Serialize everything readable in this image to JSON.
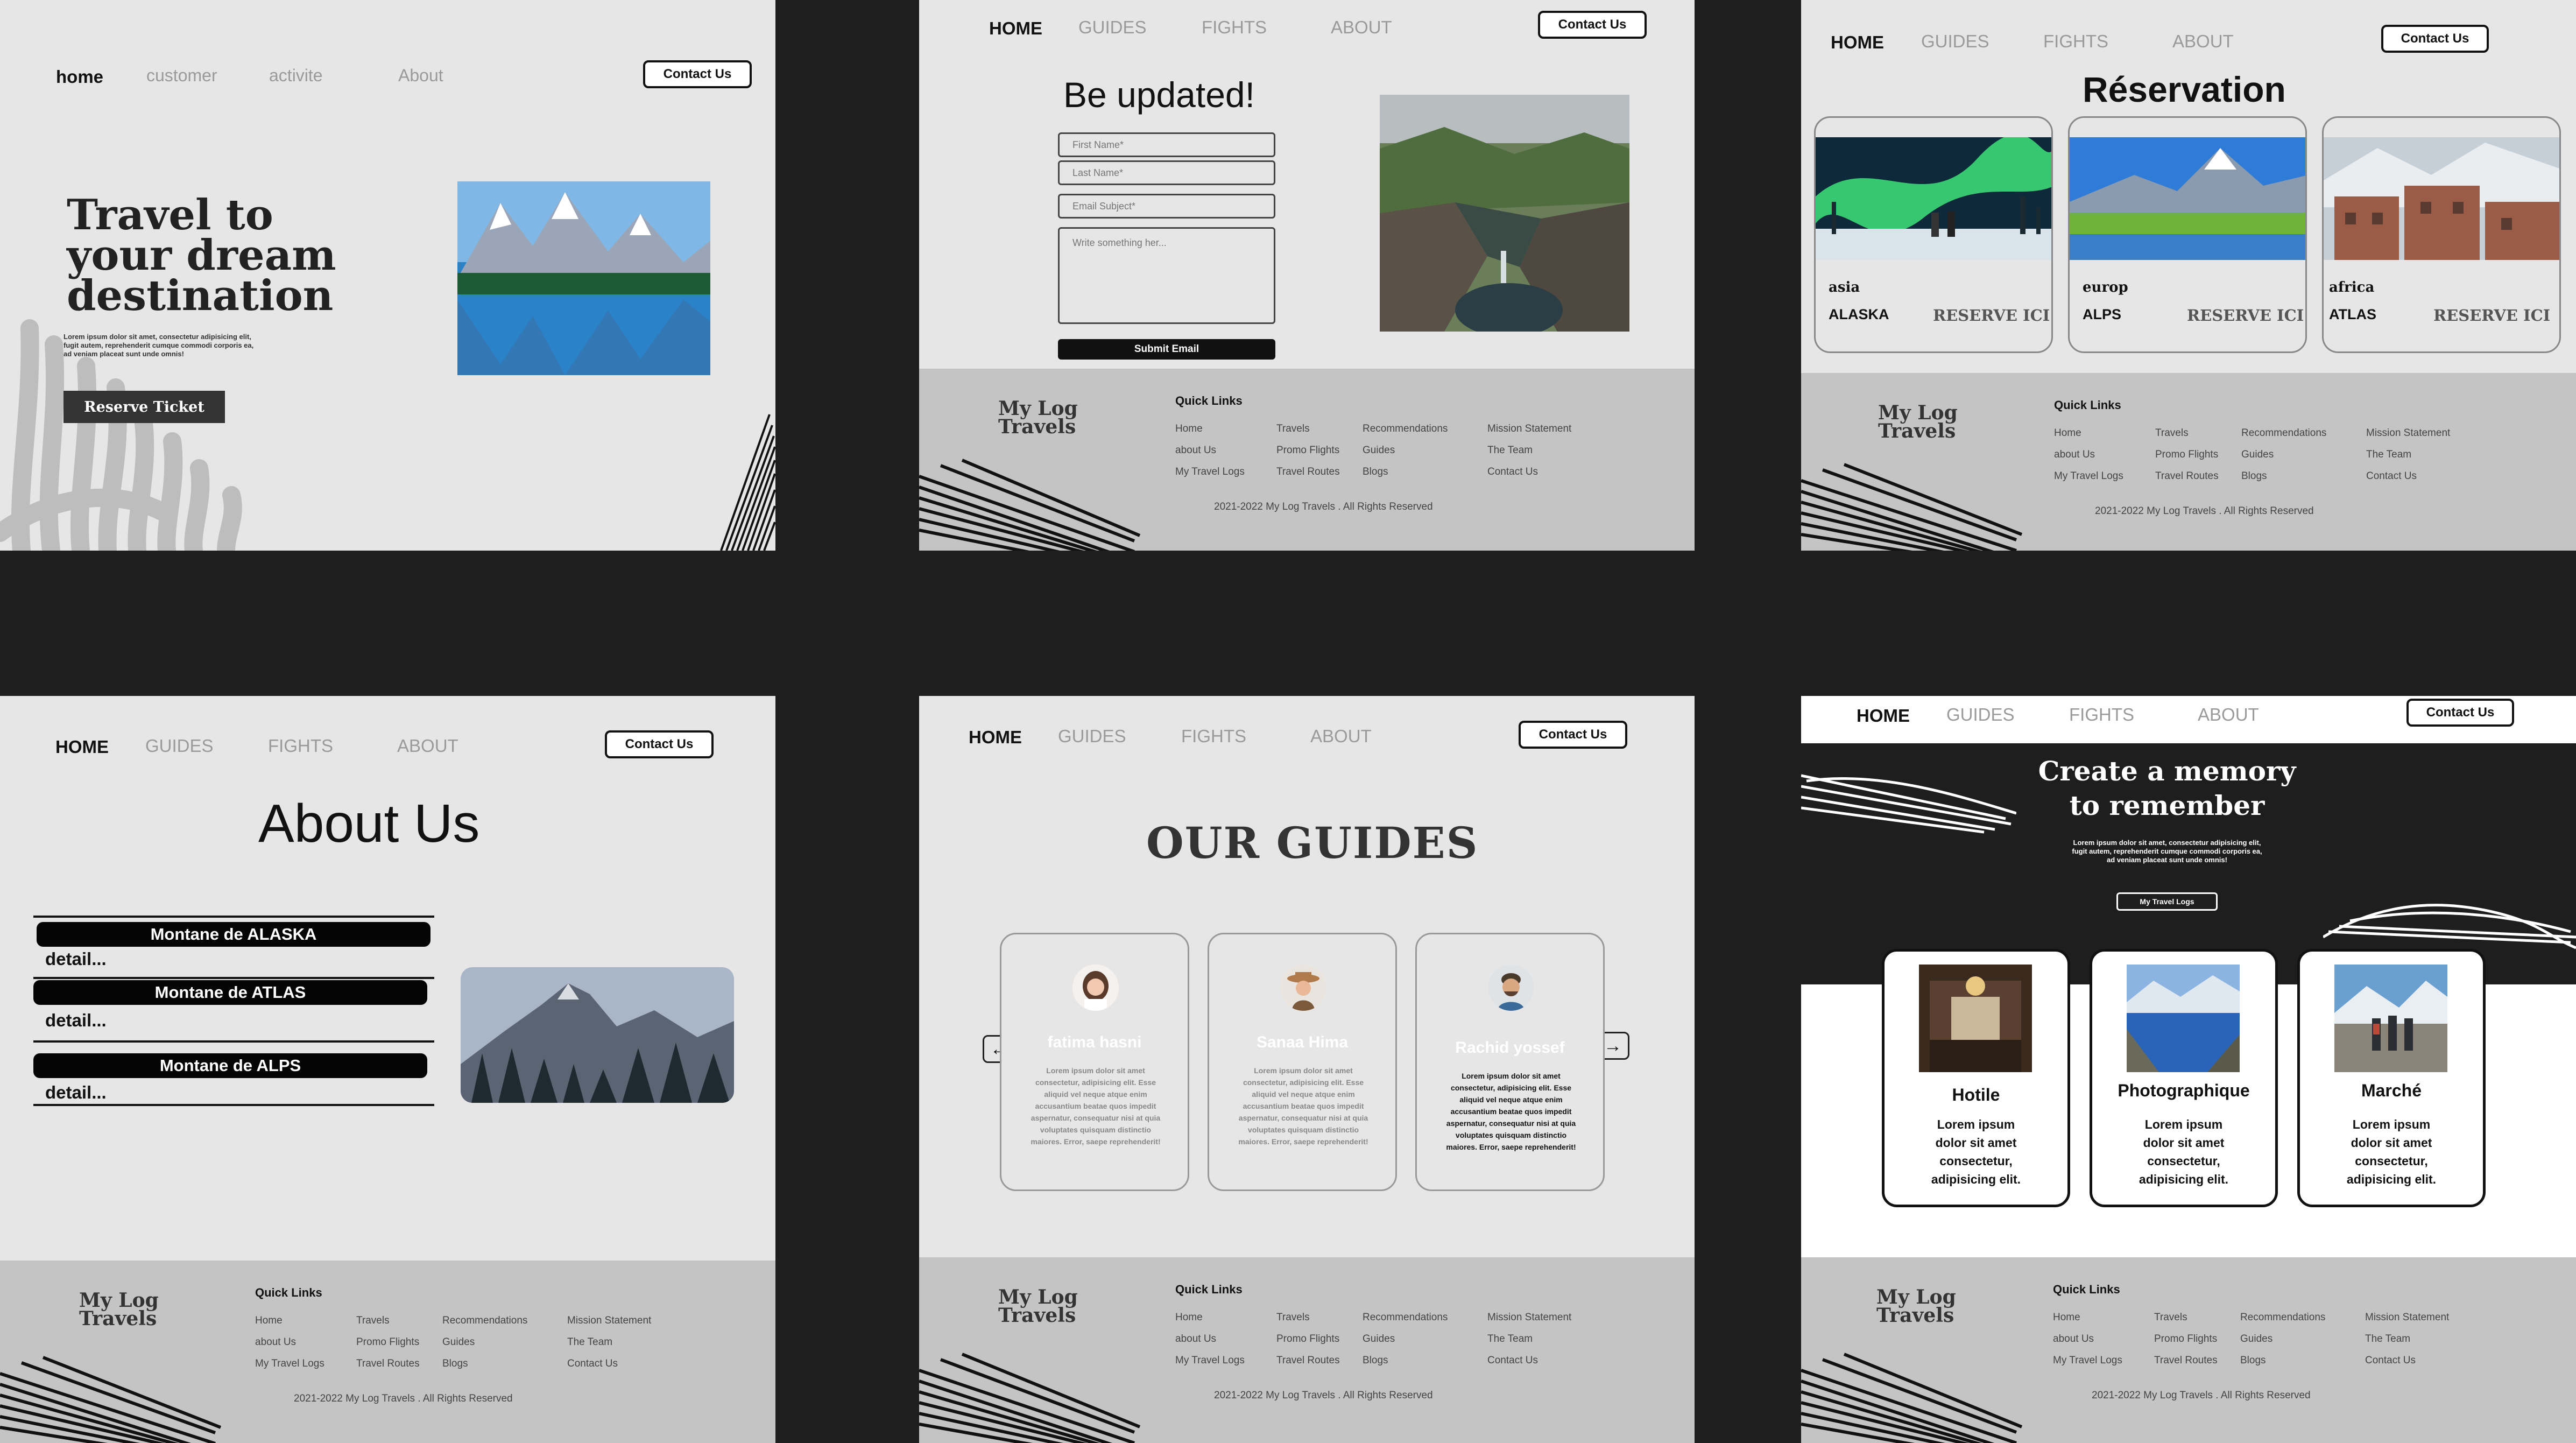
{
  "frame1": {
    "nav": [
      "home",
      "customer",
      "activite",
      "About"
    ],
    "contact": "Contact Us",
    "hero_title_lines": [
      "Travel to",
      "your dream",
      "destination"
    ],
    "hero_text_lines": [
      "Lorem ipsum dolor sit amet, consectetur adipisicing elit,",
      "fugit autem, reprehenderit cumque commodi corporis ea,",
      "ad veniam placeat sunt unde omnis!"
    ],
    "cta": "Reserve Ticket"
  },
  "frame2": {
    "nav": [
      "HOME",
      "GUIDES",
      "FIGHTS",
      "ABOUT"
    ],
    "contact": "Contact Us",
    "title": "Be updated!",
    "placeholders": {
      "first": "First Name*",
      "last": "Last Name*",
      "email": "Email Subject*",
      "message": "Write something her..."
    },
    "submit": "Submit Email"
  },
  "frame3": {
    "nav": [
      "HOME",
      "GUIDES",
      "FIGHTS",
      "ABOUT"
    ],
    "contact": "Contact Us",
    "title": "Réservation",
    "cards": [
      {
        "region": "asia",
        "place": "ALASKA",
        "cta": "RESERVE ICI"
      },
      {
        "region": "europ",
        "place": "ALPS",
        "cta": "RESERVE ICI"
      },
      {
        "region": "africa",
        "place": "ATLAS",
        "cta": "RESERVE ICI"
      }
    ]
  },
  "frame4": {
    "nav": [
      "HOME",
      "GUIDES",
      "FIGHTS",
      "ABOUT"
    ],
    "contact": "Contact Us",
    "title": "About Us",
    "items": [
      {
        "title": "Montane de ALASKA",
        "detail": "detail..."
      },
      {
        "title": "Montane de ATLAS",
        "detail": "detail..."
      },
      {
        "title": "Montane de ALPS",
        "detail": "detail..."
      }
    ]
  },
  "frame5": {
    "nav": [
      "HOME",
      "GUIDES",
      "FIGHTS",
      "ABOUT"
    ],
    "contact": "Contact Us",
    "title": "OUR GUIDES",
    "guides": [
      {
        "name": "fatima hasni",
        "text": "Lorem ipsum dolor sit amet consectetur, adipisicing elit. Esse aliquid vel neque atque enim accusantium beatae quos impedit aspernatur, consequatur nisi at quia voluptates quisquam distinctio maiores. Error, saepe reprehenderit!"
      },
      {
        "name": "Sanaa Hima",
        "text": "Lorem ipsum dolor sit amet consectetur, adipisicing elit. Esse aliquid vel neque atque enim accusantium beatae quos impedit aspernatur, consequatur nisi at quia voluptates quisquam distinctio maiores. Error, saepe reprehenderit!"
      },
      {
        "name": "Rachid yossef",
        "text": "Lorem ipsum dolor sit amet consectetur, adipisicing elit. Esse aliquid vel neque atque enim accusantium beatae quos impedit aspernatur, consequatur nisi at quia voluptates quisquam distinctio maiores. Error, saepe reprehenderit!"
      }
    ],
    "prev_arrow": "←",
    "next_arrow": "→"
  },
  "frame6": {
    "nav": [
      "HOME",
      "GUIDES",
      "FIGHTS",
      "ABOUT"
    ],
    "contact": "Contact Us",
    "hero_title_lines": [
      "Create a memory",
      "to remember"
    ],
    "hero_text_lines": [
      "Lorem ipsum dolor sit amet, consectetur adipisicing elit,",
      "fugit autem, reprehenderit cumque commodi corporis ea,",
      "ad veniam placeat sunt unde omnis!"
    ],
    "cta": "My Travel Logs",
    "services": [
      {
        "title": "Hotile",
        "lines": [
          "Lorem ipsum",
          "dolor sit amet",
          "consectetur,",
          "adipisicing elit."
        ]
      },
      {
        "title": "Photographique",
        "lines": [
          "Lorem ipsum",
          "dolor sit amet",
          "consectetur,",
          "adipisicing elit."
        ]
      },
      {
        "title": "Marché",
        "lines": [
          "Lorem ipsum",
          "dolor sit amet",
          "consectetur,",
          "adipisicing elit."
        ]
      }
    ]
  },
  "footer": {
    "logo_lines": [
      "My Log",
      "Travels"
    ],
    "quick_links": "Quick Links",
    "col1": [
      "Home",
      "about Us",
      "My Travel Logs"
    ],
    "col2": [
      "Travels",
      "Promo Flights",
      "Travel Routes"
    ],
    "col3": [
      "Recommendations",
      "Guides",
      "Blogs"
    ],
    "col4": [
      "Mission Statement",
      "The Team",
      "Contact Us"
    ],
    "copyright": "2021-2022 My Log Travels . All Rights Reserved"
  },
  "icons": [
    "arrow-left-icon",
    "arrow-right-icon"
  ],
  "colors": {
    "bg": "#e7e6e7",
    "dark": "#1e1e1e",
    "footer": "#c4c4c4",
    "black": "#050505"
  }
}
